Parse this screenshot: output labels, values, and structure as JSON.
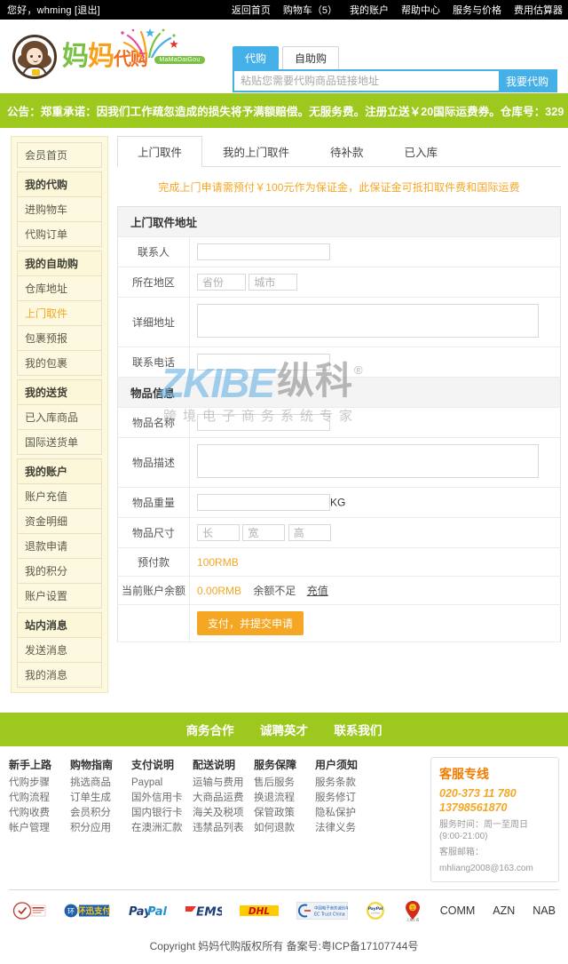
{
  "topbar": {
    "greeting": "您好，whming",
    "logout": "[退出]",
    "nav": [
      "返回首页",
      "购物车（5）",
      "我的账户",
      "帮助中心",
      "服务与价格",
      "费用估算器"
    ]
  },
  "brand": {
    "char1": "妈",
    "char2": "妈",
    "char3": "代购",
    "pinyin": "MaMaDaiGou"
  },
  "search": {
    "tabs": [
      "代购",
      "自助购"
    ],
    "active_tab": "代购",
    "placeholder": "粘贴您需要代购商品链接地址",
    "value": "",
    "button": "我要代购"
  },
  "announce": {
    "text": "公告：郑重承诺：因我们工作疏忽造成的损失将予满额赔偿。无服务费。注册立送￥20国际运费券。仓库号：329"
  },
  "sidebar": {
    "home": "会员首页",
    "groups": [
      {
        "title": "我的代购",
        "items": [
          "进购物车",
          "代购订单"
        ]
      },
      {
        "title": "我的自助购",
        "items": [
          "仓库地址",
          "上门取件",
          "包裹预报",
          "我的包裹"
        ],
        "active": "上门取件"
      },
      {
        "title": "我的送货",
        "items": [
          "已入库商品",
          "国际送货单"
        ]
      },
      {
        "title": "我的账户",
        "items": [
          "账户充值",
          "资金明细",
          "退款申请",
          "我的积分",
          "账户设置"
        ]
      },
      {
        "title": "站内消息",
        "items": [
          "发送消息",
          "我的消息"
        ]
      }
    ]
  },
  "main": {
    "tabs": [
      "上门取件",
      "我的上门取件",
      "待补款",
      "已入库"
    ],
    "active_tab": "上门取件",
    "notice": "完成上门申请需预付￥100元作为保证金，此保证金可抵扣取件费和国际运费",
    "section_address": "上门取件地址",
    "section_goods": "物品信息",
    "fields": {
      "contact_label": "联系人",
      "contact_value": "",
      "region_label": "所在地区",
      "province_placeholder": "省份",
      "city_placeholder": "城市",
      "detail_label": "详细地址",
      "detail_value": "",
      "phone_label": "联系电话",
      "phone_value": "",
      "goods_name_label": "物品名称",
      "goods_name_value": "",
      "goods_desc_label": "物品描述",
      "goods_desc_value": "",
      "weight_label": "物品重量",
      "weight_value": "",
      "weight_unit": "KG",
      "size_label": "物品尺寸",
      "size_len_placeholder": "长",
      "size_wid_placeholder": "宽",
      "size_hei_placeholder": "高",
      "prepay_label": "预付款",
      "prepay_value": "100RMB",
      "balance_label": "当前账户余额",
      "balance_value": "0.00RMB",
      "balance_warn": "余额不足",
      "recharge_link": "充值"
    },
    "submit_button": "支付，并提交申请"
  },
  "watermark": {
    "en": "ZKIBE",
    "cn": "纵科",
    "mark": "®",
    "sub": "跨境电子商务系统专家"
  },
  "footer": {
    "topnav": [
      "商务合作",
      "诚聘英才",
      "联系我们"
    ],
    "columns": [
      {
        "title": "新手上路",
        "links": [
          "代购步骤",
          "代购流程",
          "代购收费",
          "帐户管理"
        ]
      },
      {
        "title": "购物指南",
        "links": [
          "挑选商品",
          "订单生成",
          "会员积分",
          "积分应用"
        ]
      },
      {
        "title": "支付说明",
        "links": [
          "Paypal",
          "国外信用卡",
          "国内银行卡",
          "在澳洲汇款"
        ]
      },
      {
        "title": "配送说明",
        "links": [
          "运输与费用",
          "大商品运费",
          "海关及税项",
          "违禁品列表"
        ]
      },
      {
        "title": "服务保障",
        "links": [
          "售后服务",
          "换退流程",
          "保管政策",
          "如何退款"
        ]
      },
      {
        "title": "用户须知",
        "links": [
          "服务条款",
          "服务修订",
          "隐私保护",
          "法律义务"
        ]
      }
    ],
    "service": {
      "title": "客服专线",
      "phone1": "020-373 11 780",
      "phone2": "13798561870",
      "hours": "服务时间：周一至周日(9:00-21:00)",
      "email_label": "客服邮箱：",
      "email": "mhliang2008@163.com"
    },
    "partners": [
      {
        "name": "icp-cert-icon",
        "type": "icon"
      },
      {
        "name": "huanxun-pay-icon",
        "type": "icon"
      },
      {
        "name": "paypal-icon",
        "type": "icon"
      },
      {
        "name": "ems-icon",
        "type": "icon"
      },
      {
        "name": "dhl-icon",
        "type": "icon"
      },
      {
        "name": "ec-trust-china-icon",
        "type": "icon"
      },
      {
        "name": "paypal-seal-icon",
        "type": "icon"
      },
      {
        "name": "shanghai-gongshang-icon",
        "type": "icon"
      },
      {
        "name": "comm-bank",
        "type": "text",
        "label": "COMM"
      },
      {
        "name": "azn-bank",
        "type": "text",
        "label": "AZN"
      },
      {
        "name": "nab-bank",
        "type": "text",
        "label": "NAB"
      }
    ],
    "copyright": "Copyright 妈妈代购版权所有 备案号:粤ICP备17107744号"
  },
  "colors": {
    "brand_green": "#9dc81e",
    "accent_orange": "#f5a623",
    "link_blue": "#45b0e8"
  }
}
